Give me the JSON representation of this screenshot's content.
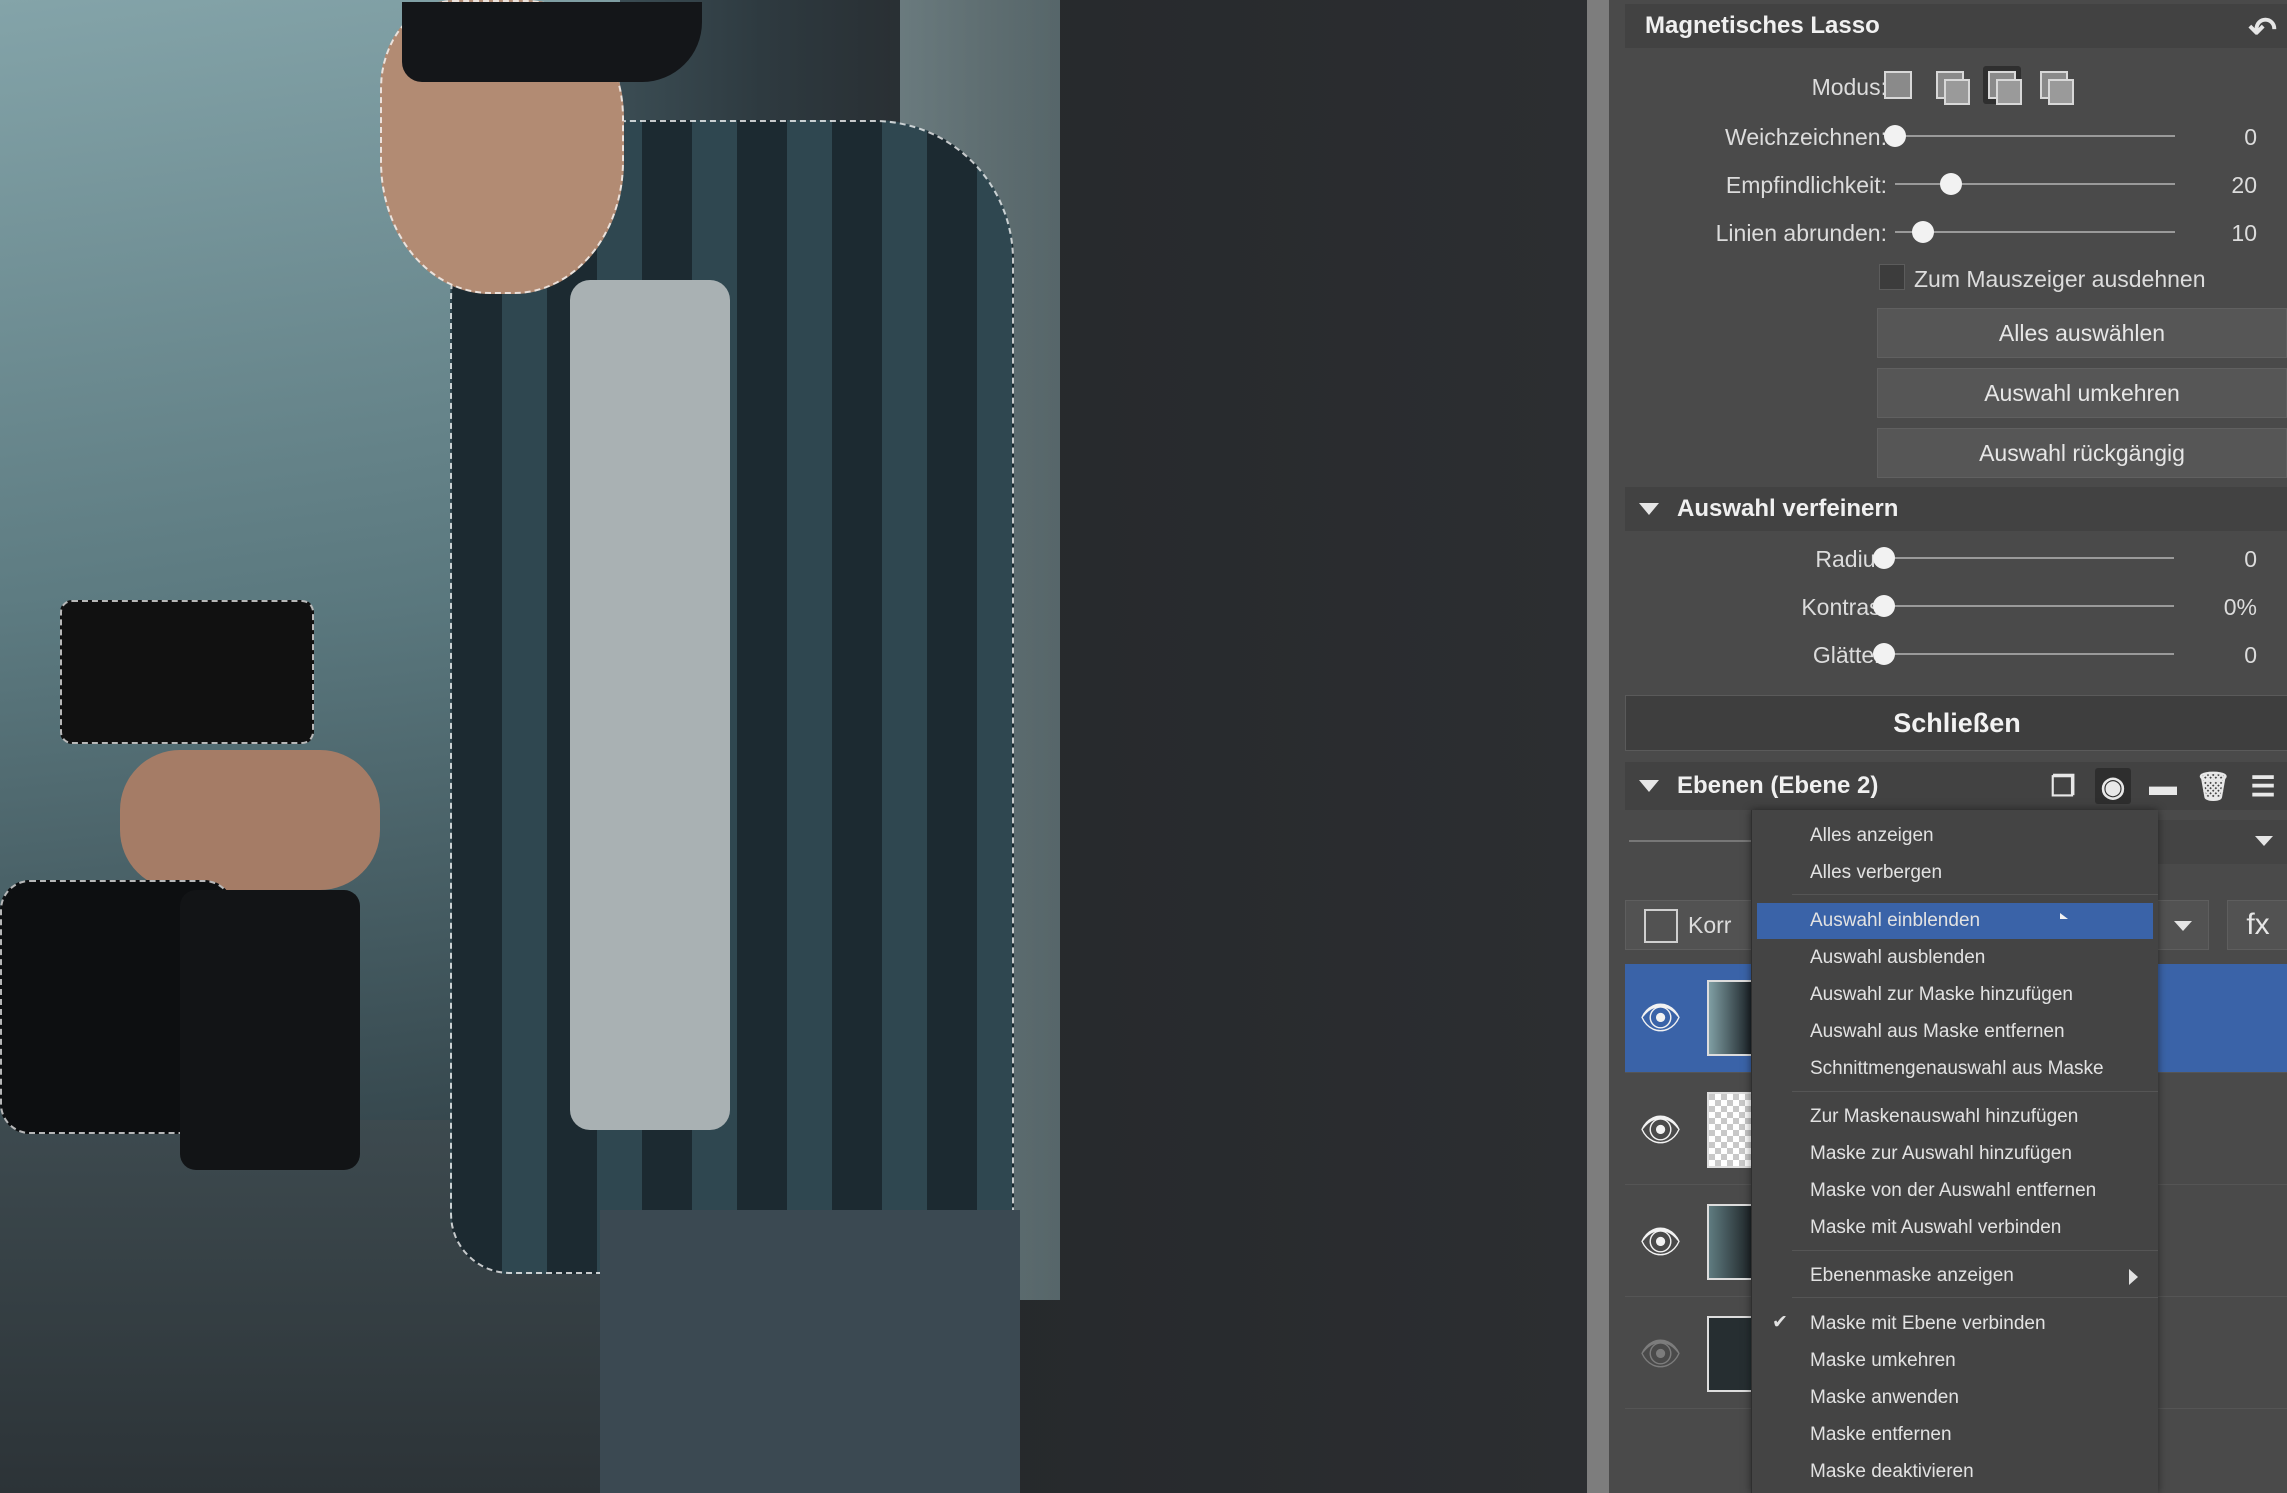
{
  "lasso": {
    "title": "Magnetisches Lasso",
    "mode_label": "Modus:",
    "mode_icons": [
      "new-selection-icon",
      "add-selection-icon",
      "subtract-selection-icon",
      "intersect-selection-icon"
    ],
    "active_mode": 2,
    "sliders": [
      {
        "label": "Weichzeichnen:",
        "value": "0",
        "fraction": 0.0
      },
      {
        "label": "Empfindlichkeit:",
        "value": "20",
        "fraction": 0.2
      },
      {
        "label": "Linien abrunden:",
        "value": "10",
        "fraction": 0.1
      }
    ],
    "checkbox_label": "Zum Mauszeiger ausdehnen",
    "checkbox_checked": false,
    "buttons": [
      "Alles auswählen",
      "Auswahl umkehren",
      "Auswahl rückgängig"
    ]
  },
  "refine": {
    "title": "Auswahl verfeinern",
    "sliders": [
      {
        "label": "Radius",
        "value": "0",
        "fraction": 0.0
      },
      {
        "label": "Kontrast",
        "value": "0%",
        "fraction": 0.0
      },
      {
        "label": "Glätten",
        "value": "0",
        "fraction": 0.0
      }
    ]
  },
  "close_label": "Schließen",
  "layers": {
    "title": "Ebenen (Ebene 2)",
    "tool_icons": [
      "duplicate-layer-icon",
      "mask-icon",
      "folder-icon",
      "trash-icon",
      "menu-icon"
    ],
    "adjust_label": "Korr",
    "fx_label": "fx",
    "rows": [
      {
        "selected": true,
        "visible": true,
        "thumb": "photo-person"
      },
      {
        "selected": false,
        "visible": true,
        "thumb": "transparent"
      },
      {
        "selected": false,
        "visible": true,
        "thumb": "photo-person"
      },
      {
        "selected": false,
        "visible": false,
        "thumb": "dark"
      }
    ]
  },
  "context_menu": {
    "items": [
      {
        "label": "Alles anzeigen"
      },
      {
        "label": "Alles verbergen"
      },
      {
        "label": "Auswahl einblenden",
        "highlighted": true
      },
      {
        "label": "Auswahl ausblenden"
      },
      {
        "label": "Auswahl zur Maske hinzufügen"
      },
      {
        "label": "Auswahl aus Maske entfernen"
      },
      {
        "label": "Schnittmengenauswahl aus Maske"
      },
      {
        "label": "Zur Maskenauswahl hinzufügen"
      },
      {
        "label": "Maske zur Auswahl hinzufügen"
      },
      {
        "label": "Maske von der Auswahl entfernen"
      },
      {
        "label": "Maske mit Auswahl verbinden"
      },
      {
        "label": "Ebenenmaske anzeigen",
        "submenu": true
      },
      {
        "label": "Maske mit Ebene verbinden",
        "checked": true
      },
      {
        "label": "Maske umkehren"
      },
      {
        "label": "Maske anwenden"
      },
      {
        "label": "Maske entfernen"
      },
      {
        "label": "Maske deaktivieren"
      }
    ]
  },
  "colors": {
    "accent": "#3a63a8",
    "panel_bg": "#4a4a4a"
  }
}
